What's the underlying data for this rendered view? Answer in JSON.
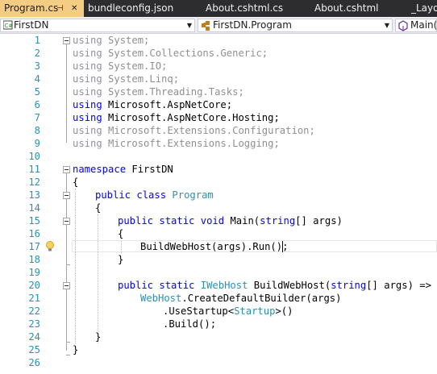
{
  "tabs": [
    {
      "label": "Program.cs",
      "active": true
    },
    {
      "label": "bundleconfig.json",
      "active": false
    },
    {
      "label": "About.cshtml.cs",
      "active": false
    },
    {
      "label": "About.cshtml",
      "active": false
    },
    {
      "label": "_Layo",
      "active": false
    }
  ],
  "navbar": {
    "project": "FirstDN",
    "type": "FirstDN.Program",
    "member": "Main("
  },
  "lines": [
    "1",
    "2",
    "3",
    "4",
    "5",
    "6",
    "7",
    "8",
    "9",
    "10",
    "11",
    "12",
    "13",
    "14",
    "15",
    "16",
    "17",
    "18",
    "19",
    "20",
    "21",
    "22",
    "23",
    "24",
    "25",
    "26"
  ],
  "code": {
    "kw_using": "using",
    "u1": " System;",
    "u2": " System.Collections.Generic;",
    "u3": " System.IO;",
    "u4": " System.Linq;",
    "u5": " System.Threading.Tasks;",
    "u6": " Microsoft.AspNetCore;",
    "u7": " Microsoft.AspNetCore.Hosting;",
    "u8": " Microsoft.Extensions.Configuration;",
    "u9": " Microsoft.Extensions.Logging;",
    "kw_namespace": "namespace",
    "ns_name": " FirstDN",
    "brace_open": "{",
    "brace_close": "}",
    "kw_public": "public",
    "kw_class": "class",
    "class_name": "Program",
    "kw_static": "static",
    "kw_void": "void",
    "main_name": " Main(",
    "kw_string": "string",
    "main_args": "[] args)",
    "call_build": "BuildWebHost(args).Run();",
    "iwebhost": "IWebHost",
    "bwh_name": " BuildWebHost(",
    "bwh_args": "[] args) =>",
    "webhost": "WebHost",
    "create": ".CreateDefaultBuilder(args)",
    "usestartup_a": ".UseStartup<",
    "startup": "Startup",
    "usestartup_b": ">()",
    "build": ".Build();"
  },
  "icons": {
    "lightbulb": "lightbulb-icon",
    "cs_project": "csharp-project-icon",
    "class": "class-icon",
    "method": "method-icon"
  },
  "colors": {
    "keyword": "#0000ff",
    "type": "#2b91af",
    "unused": "#8f8f8f",
    "line_number": "#2b91af",
    "active_tab": "#f5cc84",
    "tabbar": "#2d2d30",
    "change_marker": "#57a64a"
  }
}
